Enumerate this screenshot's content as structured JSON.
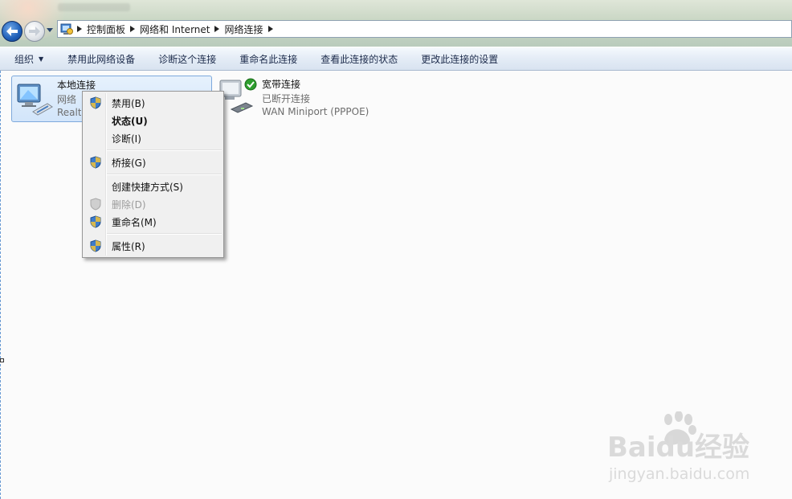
{
  "address": {
    "crumbs": [
      "控制面板",
      "网络和 Internet",
      "网络连接"
    ]
  },
  "command_bar": {
    "organize": "组织",
    "items": [
      "禁用此网络设备",
      "诊断这个连接",
      "重命名此连接",
      "查看此连接的状态",
      "更改此连接的设置"
    ]
  },
  "connections": [
    {
      "name": "本地连接",
      "line1": "网络",
      "line2": "Realtek",
      "selected": true
    },
    {
      "name": "宽带连接",
      "line1": "已断开连接",
      "line2": "WAN Miniport (PPPOE)",
      "selected": false
    }
  ],
  "context_menu": {
    "items": [
      {
        "label": "禁用(B)",
        "icon": "shield-icon",
        "bold": false,
        "disabled": false
      },
      {
        "label": "状态(U)",
        "icon": "",
        "bold": true,
        "disabled": false
      },
      {
        "label": "诊断(I)",
        "icon": "",
        "bold": false,
        "disabled": false
      },
      {
        "label": "桥接(G)",
        "icon": "shield-icon",
        "bold": false,
        "disabled": false
      },
      {
        "label": "创建快捷方式(S)",
        "icon": "",
        "bold": false,
        "disabled": false
      },
      {
        "label": "删除(D)",
        "icon": "shield-icon",
        "bold": false,
        "disabled": true
      },
      {
        "label": "重命名(M)",
        "icon": "shield-icon",
        "bold": false,
        "disabled": false
      },
      {
        "label": "属性(R)",
        "icon": "shield-icon",
        "bold": false,
        "disabled": false
      }
    ]
  },
  "watermark": {
    "brand": "Baidu经验",
    "url": "jingyan.baidu.com"
  },
  "colors": {
    "accent": "#1f5fb8",
    "selection": "#d2e5fa",
    "status_ok": "#2e9e2e"
  }
}
